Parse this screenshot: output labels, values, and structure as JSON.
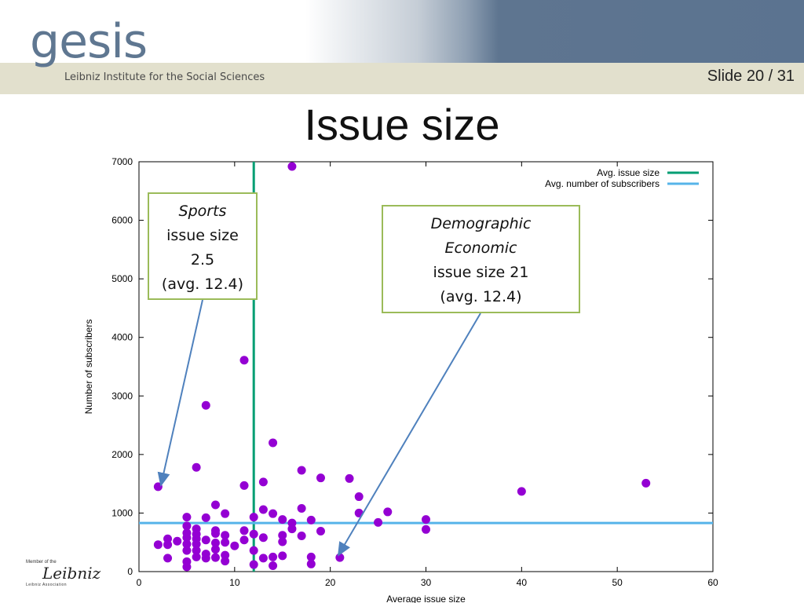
{
  "header": {
    "logo_text": "gesis",
    "logo_subtitle": "Leibniz Institute for the Social Sciences",
    "slide_label": "Slide 20 /  31"
  },
  "title": "Issue size",
  "footer": {
    "leibniz_small": "Member of the",
    "leibniz_signature": "Leibniz",
    "leibniz_association": "Leibniz Association"
  },
  "callouts": {
    "left": {
      "line1": "Sports",
      "line2": "issue size",
      "line3": "2.5",
      "line4": "(avg. 12.4)"
    },
    "right": {
      "line1": "Demographic",
      "line2": "Economic",
      "line3": "issue size 21",
      "line4": "(avg. 12.4)"
    }
  },
  "colors": {
    "points": "#9400d3",
    "avg_issue_line": "#009e73",
    "avg_subscribers_line": "#56b4e9",
    "callout_border": "#9bbb59",
    "arrow": "#4f81bd",
    "header_blue": "#5b7390",
    "header_strip": "#e2e0cd"
  },
  "chart_data": {
    "type": "scatter",
    "xlabel": "Average issue size",
    "ylabel": "Number of subscribers",
    "xlim": [
      0,
      60
    ],
    "ylim": [
      0,
      7000
    ],
    "xticks": [
      0,
      10,
      20,
      30,
      40,
      50,
      60
    ],
    "yticks": [
      0,
      1000,
      2000,
      3000,
      4000,
      5000,
      6000,
      7000
    ],
    "grid": false,
    "legend_position": "top-right",
    "legend": [
      "Avg. issue size",
      "Avg. number of subscribers"
    ],
    "reference_lines": {
      "avg_issue_size": 12,
      "avg_subscribers": 830
    },
    "series": [
      {
        "points": [
          [
            2,
            1450
          ],
          [
            2,
            460
          ],
          [
            3,
            560
          ],
          [
            3,
            460
          ],
          [
            3,
            230
          ],
          [
            4,
            520
          ],
          [
            5,
            930
          ],
          [
            5,
            780
          ],
          [
            5,
            660
          ],
          [
            5,
            580
          ],
          [
            5,
            470
          ],
          [
            5,
            360
          ],
          [
            5,
            170
          ],
          [
            5,
            80
          ],
          [
            6,
            1780
          ],
          [
            6,
            730
          ],
          [
            6,
            640
          ],
          [
            6,
            560
          ],
          [
            6,
            470
          ],
          [
            6,
            360
          ],
          [
            6,
            250
          ],
          [
            7,
            2840
          ],
          [
            7,
            920
          ],
          [
            7,
            540
          ],
          [
            7,
            300
          ],
          [
            7,
            230
          ],
          [
            8,
            1140
          ],
          [
            8,
            700
          ],
          [
            8,
            650
          ],
          [
            8,
            490
          ],
          [
            8,
            380
          ],
          [
            8,
            240
          ],
          [
            9,
            990
          ],
          [
            9,
            620
          ],
          [
            9,
            500
          ],
          [
            9,
            280
          ],
          [
            9,
            180
          ],
          [
            10,
            440
          ],
          [
            11,
            3610
          ],
          [
            11,
            1470
          ],
          [
            11,
            700
          ],
          [
            11,
            540
          ],
          [
            12,
            930
          ],
          [
            12,
            640
          ],
          [
            12,
            360
          ],
          [
            12,
            120
          ],
          [
            13,
            1530
          ],
          [
            13,
            1060
          ],
          [
            13,
            580
          ],
          [
            13,
            230
          ],
          [
            14,
            2200
          ],
          [
            14,
            990
          ],
          [
            14,
            250
          ],
          [
            14,
            100
          ],
          [
            15,
            890
          ],
          [
            15,
            620
          ],
          [
            15,
            510
          ],
          [
            15,
            270
          ],
          [
            16,
            6920
          ],
          [
            16,
            830
          ],
          [
            16,
            730
          ],
          [
            17,
            1730
          ],
          [
            17,
            1080
          ],
          [
            17,
            610
          ],
          [
            18,
            880
          ],
          [
            18,
            250
          ],
          [
            18,
            130
          ],
          [
            19,
            1600
          ],
          [
            19,
            690
          ],
          [
            21,
            240
          ],
          [
            22,
            1590
          ],
          [
            23,
            1280
          ],
          [
            23,
            1000
          ],
          [
            25,
            840
          ],
          [
            26,
            1020
          ],
          [
            30,
            890
          ],
          [
            30,
            720
          ],
          [
            40,
            1370
          ],
          [
            53,
            1510
          ]
        ]
      }
    ]
  }
}
